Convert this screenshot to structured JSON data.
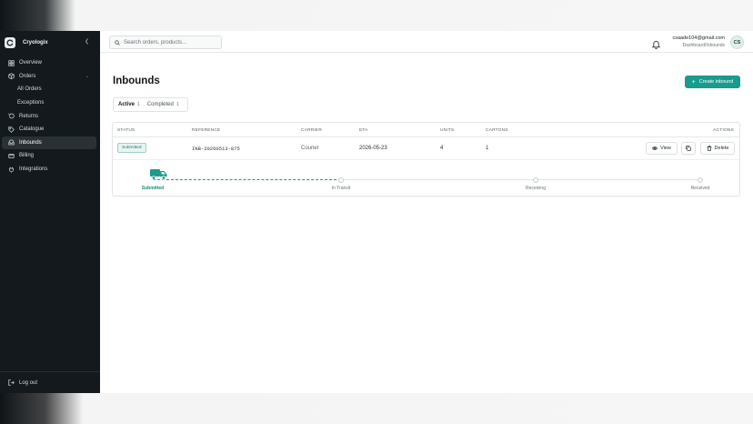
{
  "app": {
    "name": "Cryologix"
  },
  "sidebar": {
    "items": [
      {
        "label": "Overview",
        "icon": "grid-icon"
      },
      {
        "label": "Orders",
        "icon": "box-icon"
      },
      {
        "label": "All Orders"
      },
      {
        "label": "Exceptions"
      },
      {
        "label": "Returns",
        "icon": "return-icon"
      },
      {
        "label": "Catalogue",
        "icon": "tag-icon"
      },
      {
        "label": "Inbounds",
        "icon": "inbox-icon",
        "active": true
      },
      {
        "label": "Billing",
        "icon": "card-icon"
      },
      {
        "label": "Integrations",
        "icon": "plug-icon"
      }
    ],
    "logout": "Log out"
  },
  "header": {
    "search_placeholder": "Search orders, products...",
    "email": "csaade104@gmail.com",
    "breadcrumb": "Dashboard/Inbounds",
    "avatar_initials": "CS"
  },
  "page": {
    "title": "Inbounds",
    "create_label": "Create inbound",
    "tabs": [
      {
        "label": "Active",
        "count": "1"
      },
      {
        "label": "Completed",
        "count": "1"
      }
    ]
  },
  "table": {
    "columns": [
      "STATUS",
      "REFERENCE",
      "CARRIER",
      "ETA",
      "UNITS",
      "CARTONS",
      "ACTIONS"
    ],
    "rows": [
      {
        "status": "Submitted",
        "reference": "INB-20260513-875",
        "carrier": "Courier",
        "eta": "2026-05-23",
        "units": "4",
        "cartons": "1",
        "view_label": "View",
        "delete_label": "Delete"
      }
    ],
    "progress_steps": [
      "Submitted",
      "In Transit",
      "Receiving",
      "Received"
    ],
    "current_step": 1
  },
  "colors": {
    "accent": "#1a9b8c",
    "sidebar_bg": "#13191d"
  }
}
